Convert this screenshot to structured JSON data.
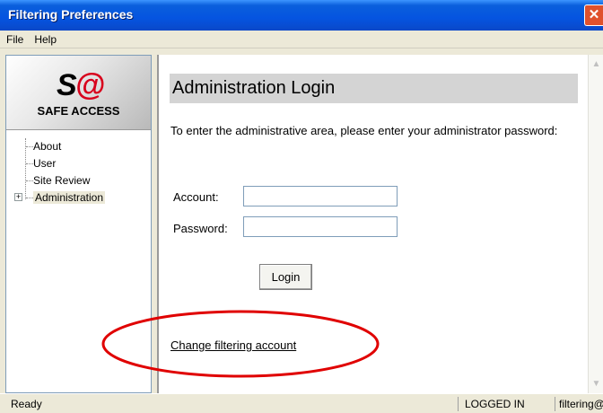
{
  "window": {
    "title": "Filtering Preferences",
    "close_glyph": "✕"
  },
  "menu": {
    "items": [
      "File",
      "Help"
    ]
  },
  "logo": {
    "mark_s": "S",
    "mark_at": "@",
    "name": "SAFE ACCESS"
  },
  "tree": {
    "items": [
      {
        "label": "About"
      },
      {
        "label": "User"
      },
      {
        "label": "Site Review"
      },
      {
        "label": "Administration",
        "expander": "+",
        "selected": true
      }
    ]
  },
  "main": {
    "heading": "Administration Login",
    "instructions": "To enter the administrative area, please enter your administrator password:",
    "account_label": "Account:",
    "account_value": "",
    "password_label": "Password:",
    "password_value": "",
    "login_label": "Login",
    "change_link": "Change filtering account"
  },
  "annotation": {
    "color": "#e00000",
    "shape": "ellipse"
  },
  "status": {
    "left": "Ready",
    "state": "LOGGED IN",
    "user": "filtering@safe"
  },
  "colors": {
    "titlebar": "#0554e0",
    "close": "#e0512c"
  }
}
